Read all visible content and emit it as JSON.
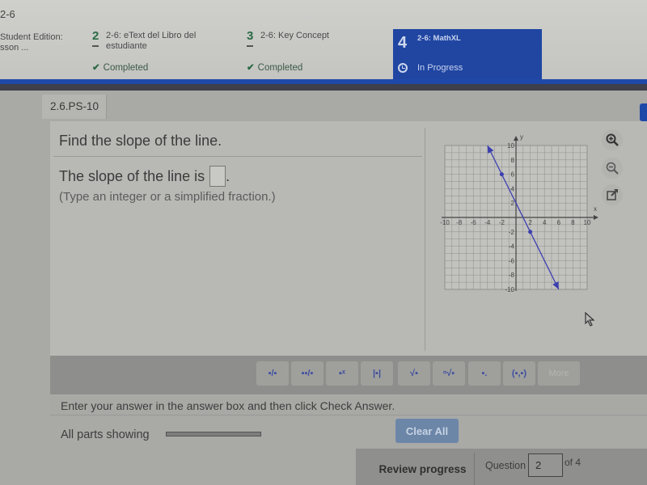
{
  "header": {
    "breadcrumb": "2-6",
    "steps": [
      {
        "number": "",
        "title": "Student Edition:",
        "subtitle": "sson ...",
        "status": ""
      },
      {
        "number": "2",
        "title": "2-6: eText del Libro del",
        "subtitle": "estudiante",
        "status": "Completed"
      },
      {
        "number": "3",
        "title": "2-6: Key Concept",
        "subtitle": "",
        "status": "Completed"
      },
      {
        "number": "4",
        "title": "2-6: MathXL",
        "subtitle": "",
        "status": "In Progress"
      }
    ],
    "colors": {
      "active_step": "#2046a2",
      "completed": "#2b6b45"
    }
  },
  "question": {
    "id": "2.6.PS-10",
    "prompt": "Find the slope of the line.",
    "answer_prefix": "The slope of the line is",
    "answer_value": "",
    "answer_suffix": ".",
    "hint": "(Type an integer or a simplified fraction.)"
  },
  "graph_tools": [
    {
      "name": "zoom-in",
      "icon": "zoom-in-icon"
    },
    {
      "name": "zoom-out",
      "icon": "zoom-out-icon"
    },
    {
      "name": "pop-out",
      "icon": "pop-out-icon"
    }
  ],
  "math_toolbar": {
    "buttons": [
      {
        "name": "fraction",
        "glyph": "▪/▪"
      },
      {
        "name": "mixed-number",
        "glyph": "▪▪/▪"
      },
      {
        "name": "exponent",
        "glyph": "▪ˣ"
      },
      {
        "name": "absolute-value",
        "glyph": "|▪|"
      },
      {
        "name": "square-root",
        "glyph": "√▪"
      },
      {
        "name": "nth-root",
        "glyph": "ⁿ√▪"
      },
      {
        "name": "decimal",
        "glyph": "▪."
      },
      {
        "name": "ordered-pair",
        "glyph": "(▪,▪)"
      },
      {
        "name": "more",
        "glyph": "More"
      }
    ]
  },
  "instructions": "Enter your answer in the answer box and then click Check Answer.",
  "parts_label": "All parts showing",
  "parts_progress": 1.0,
  "clear_all_label": "Clear All",
  "footer": {
    "review_label": "Review progress",
    "question_label": "Question",
    "question_number": "2",
    "of_total": "of 4"
  },
  "chart_data": {
    "type": "line",
    "title": "",
    "xlabel": "x",
    "ylabel": "y",
    "xlim": [
      -10,
      10
    ],
    "ylim": [
      -10,
      10
    ],
    "x_ticks": [
      -10,
      -8,
      -6,
      -4,
      -2,
      2,
      4,
      6,
      8,
      10
    ],
    "y_ticks": [
      -10,
      -8,
      -6,
      -4,
      -2,
      2,
      4,
      6,
      8,
      10
    ],
    "grid": true,
    "series": [
      {
        "name": "line",
        "color": "#3c3fb0",
        "endpoints": [
          [
            -4,
            10
          ],
          [
            6,
            -10
          ]
        ],
        "points": [
          [
            -2,
            6
          ],
          [
            2,
            -2
          ]
        ]
      }
    ]
  }
}
